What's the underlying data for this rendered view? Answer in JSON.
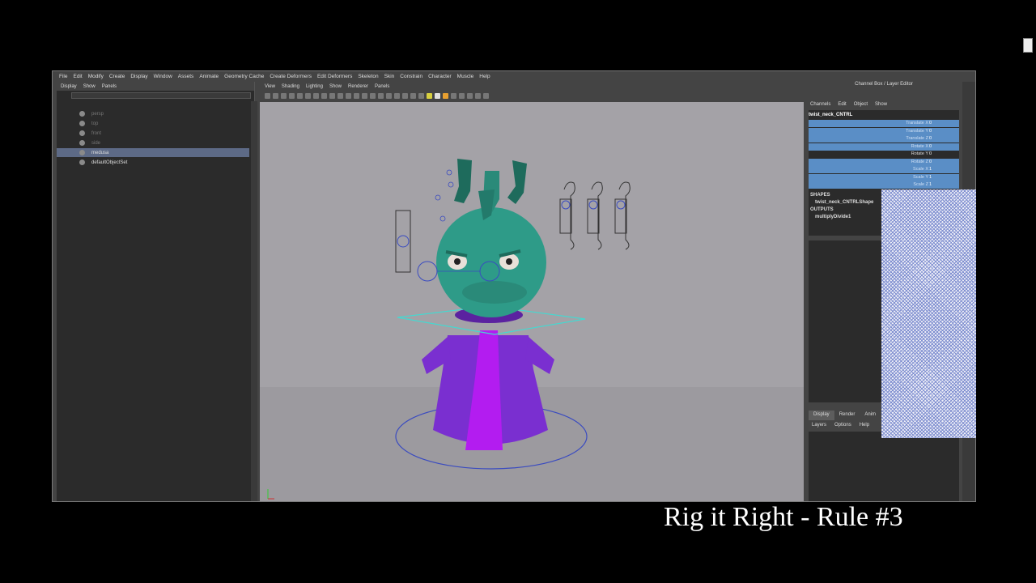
{
  "menubar": [
    "File",
    "Edit",
    "Modify",
    "Create",
    "Display",
    "Window",
    "Assets",
    "Animate",
    "Geometry Cache",
    "Create Deformers",
    "Edit Deformers",
    "Skeleton",
    "Skin",
    "Constrain",
    "Character",
    "Muscle",
    "Help"
  ],
  "outliner": {
    "menu": [
      "Display",
      "Show",
      "Panels"
    ],
    "items": [
      {
        "label": "persp",
        "dim": true
      },
      {
        "label": "top",
        "dim": true
      },
      {
        "label": "front",
        "dim": true
      },
      {
        "label": "side",
        "dim": true
      },
      {
        "label": "medusa",
        "dim": false,
        "selected": true
      },
      {
        "label": "defaultObjectSet",
        "dim": false
      }
    ]
  },
  "viewport": {
    "menu": [
      "View",
      "Shading",
      "Lighting",
      "Show",
      "Renderer",
      "Panels"
    ]
  },
  "channel_box": {
    "title": "Channel Box / Layer Editor",
    "menu": [
      "Channels",
      "Edit",
      "Object",
      "Show"
    ],
    "node_name": "twist_neck_CNTRL",
    "attributes": [
      {
        "name": "Translate X",
        "value": "0",
        "highlight": true
      },
      {
        "name": "Translate Y",
        "value": "0",
        "highlight": true
      },
      {
        "name": "Translate Z",
        "value": "0",
        "highlight": true
      },
      {
        "name": "Rotate X",
        "value": "0",
        "highlight": true
      },
      {
        "name": "Rotate Y",
        "value": "0",
        "highlight": false
      },
      {
        "name": "Rotate Z",
        "value": "0",
        "highlight": true
      },
      {
        "name": "Scale X",
        "value": "1",
        "highlight": true
      },
      {
        "name": "Scale Y",
        "value": "1",
        "highlight": true
      },
      {
        "name": "Scale Z",
        "value": "1",
        "highlight": true
      }
    ],
    "shapes_label": "SHAPES",
    "shape_name": "twist_neck_CNTRLShape",
    "outputs_label": "OUTPUTS",
    "output_name": "multiplyDivide1"
  },
  "layer_editor": {
    "tabs": [
      "Display",
      "Render",
      "Anim"
    ],
    "menu": [
      "Layers",
      "Options",
      "Help"
    ]
  },
  "caption": "Rig it Right - Rule #3",
  "colors": {
    "body": "#7a2fd0",
    "body_stripe": "#b31cf0",
    "head": "#2e9b88",
    "viewport_bg": "#a09ea3",
    "selection_blue": "#5a8ec6",
    "control_cyan": "#45d8d0"
  }
}
